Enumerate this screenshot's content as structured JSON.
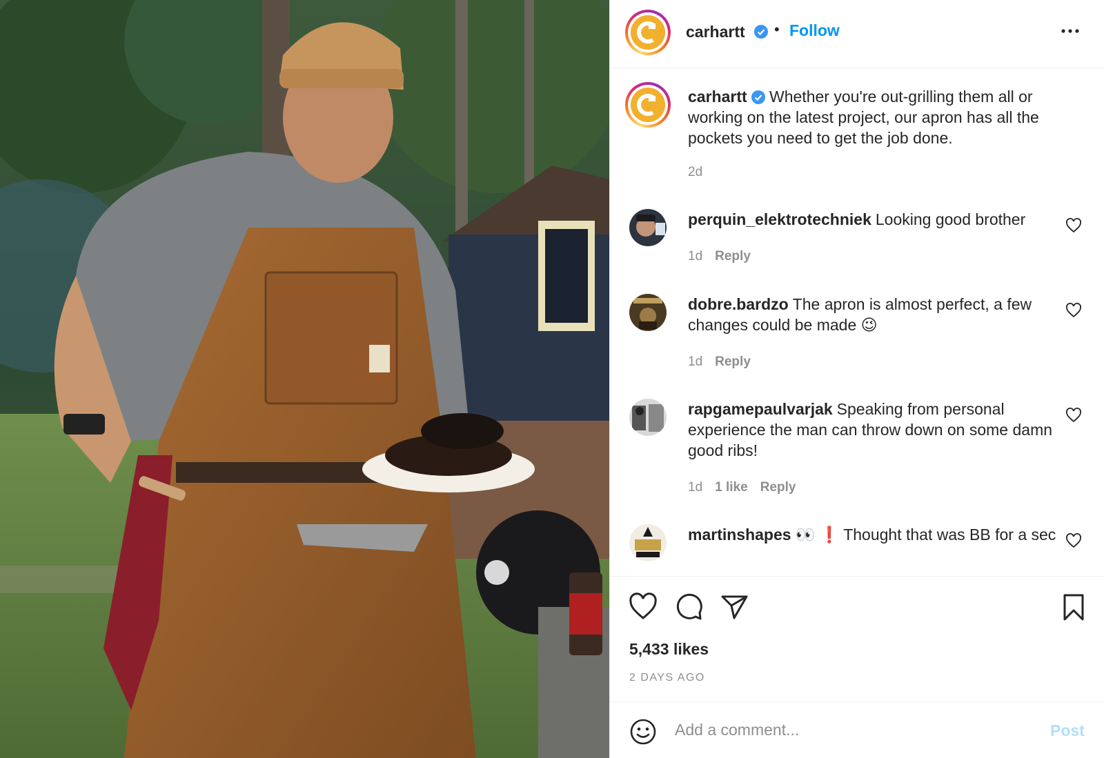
{
  "post": {
    "author": "carhartt",
    "follow_label": "Follow",
    "separator": "•",
    "caption": "Whether you're out-grilling them all or working on the latest project, our apron has all the pockets you need to get the job done.",
    "caption_time": "2d",
    "likes": "5,433 likes",
    "posted_ago": "2 DAYS AGO",
    "comments": [
      {
        "user": "perquin_elektrotechniek",
        "text": "Looking good brother",
        "time": "1d",
        "likes": "",
        "reply": "Reply"
      },
      {
        "user": "dobre.bardzo",
        "text": "The apron is almost perfect, a few changes could be made 😉",
        "time": "1d",
        "likes": "",
        "reply": "Reply"
      },
      {
        "user": "rapgamepaulvarjak",
        "text": "Speaking from personal experience the man can throw down on some damn good ribs!",
        "time": "1d",
        "likes": "1 like",
        "reply": "Reply"
      },
      {
        "user": "martinshapes",
        "text": "👀 ❗ Thought that was BB for a sec",
        "time": "",
        "likes": "",
        "reply": ""
      }
    ]
  },
  "add_comment": {
    "placeholder": "Add a comment...",
    "post_label": "Post"
  },
  "icons": {
    "more": "more-options-icon",
    "verified": "verified-badge-icon",
    "like": "heart-icon",
    "comment": "comment-bubble-icon",
    "share": "paper-plane-icon",
    "save": "bookmark-icon",
    "emoji": "emoji-smile-icon"
  },
  "colors": {
    "follow": "#0095f6",
    "verified": "#3897f0",
    "brand_logo": "#f2b02f",
    "post_disabled": "#b2dffc",
    "meta": "#8e8e8e"
  }
}
